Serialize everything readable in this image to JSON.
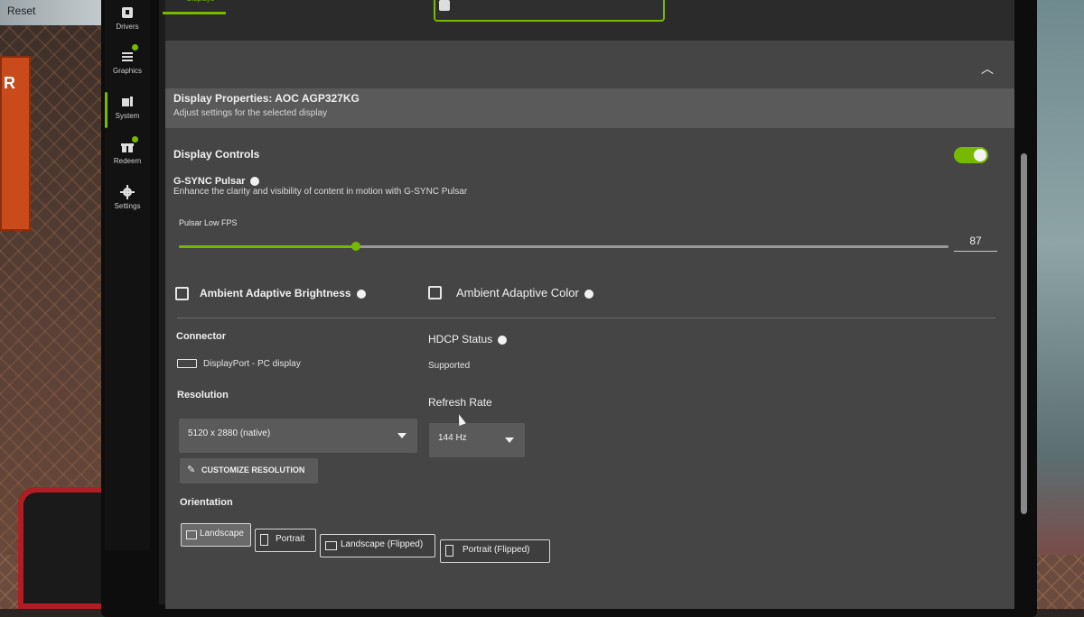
{
  "top_left": {
    "reset_label": "Reset"
  },
  "sidebar": {
    "items": [
      {
        "label": "Drivers",
        "icon": "drivers-icon"
      },
      {
        "label": "Graphics",
        "icon": "graphics-icon"
      },
      {
        "label": "System",
        "icon": "system-icon",
        "active": true
      },
      {
        "label": "Redeem",
        "icon": "gift-icon"
      },
      {
        "label": "Settings",
        "icon": "gear-icon"
      }
    ]
  },
  "tabs": {
    "display_label": "Displays"
  },
  "panel": {
    "title": "Display Properties: AOC AGP327KG",
    "subtitle": "Adjust settings for the selected display"
  },
  "display_controls": {
    "label": "Display Controls",
    "enabled": true
  },
  "gsync": {
    "label": "G-SYNC Pulsar",
    "description": "Enhance the clarity and visibility of content in motion with G-SYNC Pulsar"
  },
  "slider": {
    "label": "Pulsar Low FPS",
    "value": "87",
    "fill_fraction": 0.23
  },
  "checkboxes": {
    "ambient_brightness": "Ambient Adaptive Brightness",
    "ambient_color": "Ambient Adaptive Color"
  },
  "connector": {
    "label": "Connector",
    "value": "DisplayPort - PC display"
  },
  "hdcp": {
    "label": "HDCP Status",
    "value": "Supported"
  },
  "resolution": {
    "label": "Resolution",
    "value": "5120 x 2880 (native)",
    "customize_label": "CUSTOMIZE RESOLUTION"
  },
  "refresh": {
    "label": "Refresh Rate",
    "value": "144 Hz"
  },
  "orientation": {
    "label": "Orientation",
    "options": [
      "Landscape",
      "Portrait",
      "Landscape (Flipped)",
      "Portrait (Flipped)"
    ],
    "selected": "Landscape"
  },
  "colors": {
    "accent": "#76b900"
  }
}
